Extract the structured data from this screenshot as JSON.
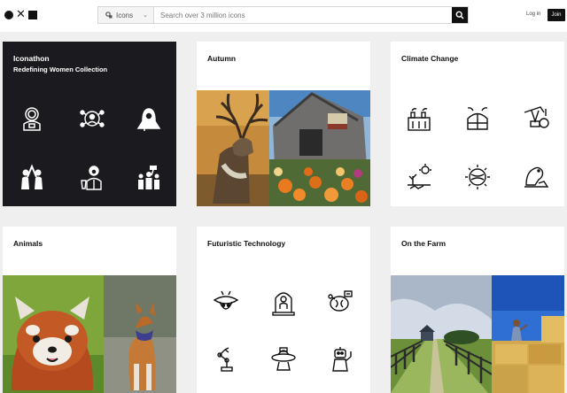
{
  "header": {
    "search_category": "Icons",
    "search_placeholder": "Search over 3 million icons",
    "login_label": "Log in",
    "join_label": "Join"
  },
  "collections": [
    {
      "title": "Iconathon",
      "subtitle": "Redefining Women Collection"
    },
    {
      "title": "Autumn"
    },
    {
      "title": "Climate Change"
    },
    {
      "title": "Animals"
    },
    {
      "title": "Futuristic Technology"
    },
    {
      "title": "On the Farm"
    }
  ],
  "icons": {
    "iconathon": [
      "astronaut-woman-icon",
      "global-network-woman-icon",
      "hijab-woman-icon",
      "high-five-icon",
      "scientist-woman-icon",
      "protest-group-icon"
    ],
    "climate_change": [
      "factory-pollution-icon",
      "earth-greenhouse-icon",
      "oil-pump-icon",
      "drought-sun-icon",
      "global-warming-icon",
      "polar-bear-icon"
    ],
    "futuristic_technology": [
      "alien-spaceship-icon",
      "hologram-person-icon",
      "brain-circuit-icon",
      "robot-arm-icon",
      "ufo-icon",
      "robot-assistant-icon"
    ]
  },
  "colors": {
    "dark_card": "#1b1b1f",
    "background": "#efefef",
    "accent": "#111111"
  }
}
